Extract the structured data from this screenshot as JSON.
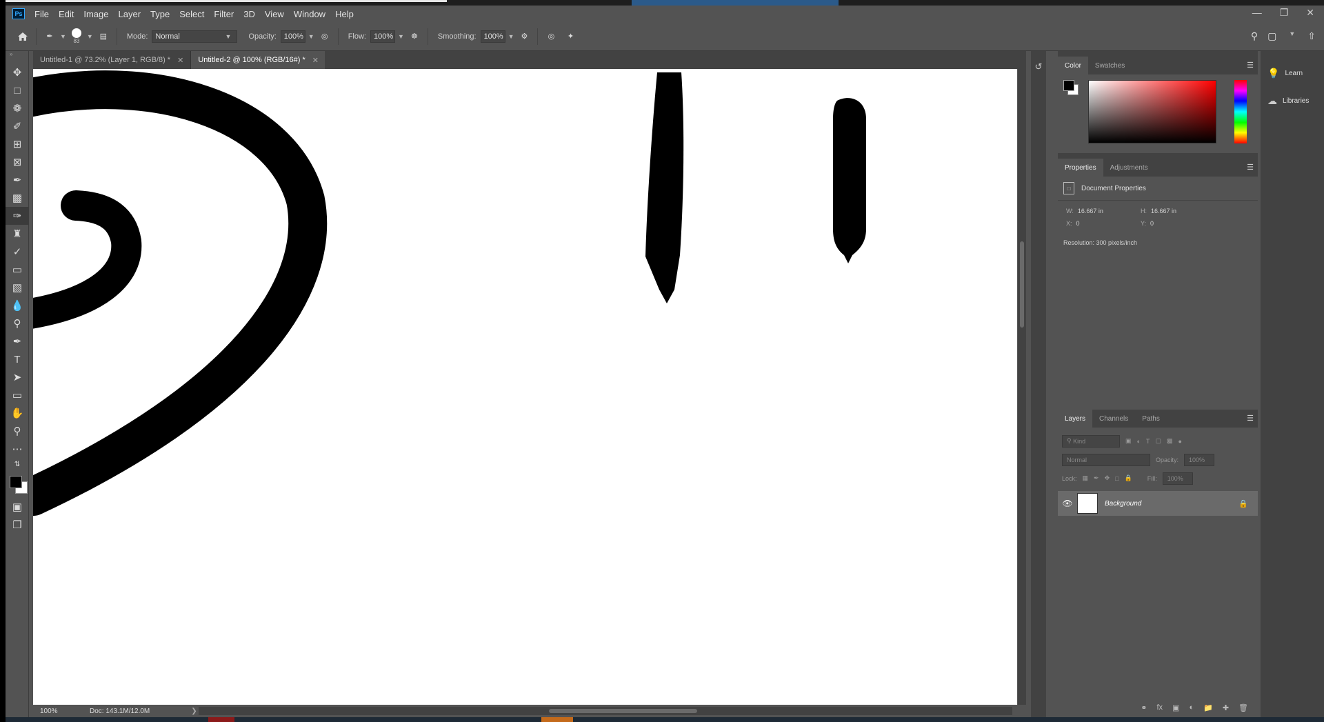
{
  "app": {
    "logo": "Ps"
  },
  "menu": [
    "File",
    "Edit",
    "Image",
    "Layer",
    "Type",
    "Select",
    "Filter",
    "3D",
    "View",
    "Window",
    "Help"
  ],
  "options": {
    "brush_size": "83",
    "mode_label": "Mode:",
    "mode_value": "Normal",
    "opacity_label": "Opacity:",
    "opacity_value": "100%",
    "flow_label": "Flow:",
    "flow_value": "100%",
    "smoothing_label": "Smoothing:",
    "smoothing_value": "100%"
  },
  "tabs": [
    {
      "label": "Untitled-1 @ 73.2% (Layer 1, RGB/8) *",
      "active": false
    },
    {
      "label": "Untitled-2 @ 100% (RGB/16#) *",
      "active": true
    }
  ],
  "status": {
    "zoom": "100%",
    "doc": "Doc: 143.1M/12.0M"
  },
  "color_panel": {
    "tabs": [
      "Color",
      "Swatches"
    ],
    "foreground": "#000000",
    "background": "#ffffff",
    "hue": "#ff0000"
  },
  "properties_panel": {
    "tabs": [
      "Properties",
      "Adjustments"
    ],
    "title": "Document Properties",
    "w_label": "W:",
    "w_value": "16.667 in",
    "h_label": "H:",
    "h_value": "16.667 in",
    "x_label": "X:",
    "x_value": "0",
    "y_label": "Y:",
    "y_value": "0",
    "resolution": "Resolution: 300 pixels/inch"
  },
  "layers_panel": {
    "tabs": [
      "Layers",
      "Channels",
      "Paths"
    ],
    "kind_placeholder": "Kind",
    "blend_mode": "Normal",
    "opacity_label": "Opacity:",
    "opacity_value": "100%",
    "lock_label": "Lock:",
    "fill_label": "Fill:",
    "fill_value": "100%",
    "layers": [
      {
        "name": "Background",
        "visible": true,
        "locked": true
      }
    ]
  },
  "side_panels": [
    {
      "label": "Learn",
      "icon": "lightbulb-icon"
    },
    {
      "label": "Libraries",
      "icon": "libraries-icon"
    }
  ]
}
